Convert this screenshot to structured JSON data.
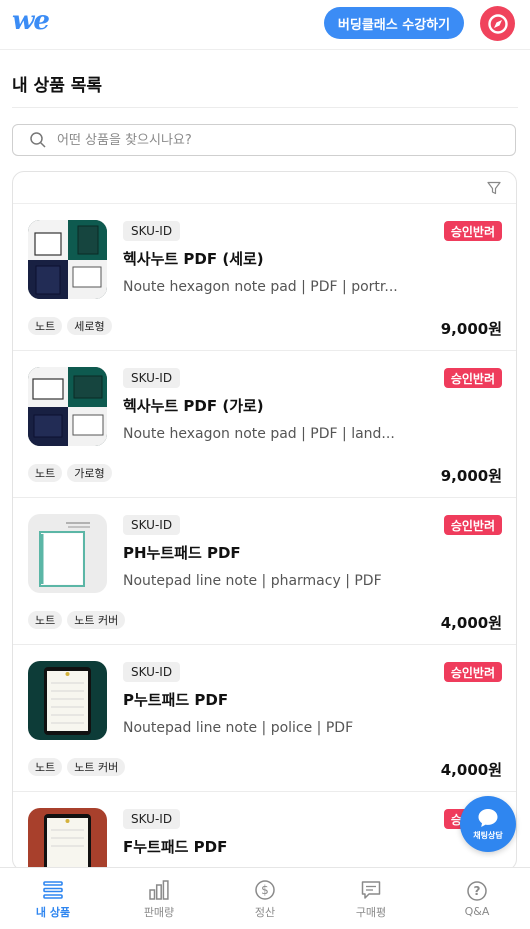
{
  "header": {
    "logo": "we",
    "cta_label": "버딩클래스 수강하기",
    "profile_icon": "compass-icon",
    "brand_color": "#3b8cf5",
    "profile_color": "#f0435c"
  },
  "page": {
    "title": "내 상품 목록"
  },
  "search": {
    "placeholder": "어떤 상품을 찾으시나요?",
    "value": ""
  },
  "filter": {
    "icon": "filter-icon"
  },
  "products": [
    {
      "sku": "SKU-ID",
      "status": "승인반려",
      "name": "헥사누트 PDF (세로)",
      "description": "Noute hexagon note pad | PDF | portr...",
      "tags": [
        "노트",
        "세로형"
      ],
      "price": "9,000원"
    },
    {
      "sku": "SKU-ID",
      "status": "승인반려",
      "name": "헥사누트 PDF (가로)",
      "description": "Noute hexagon note pad | PDF | land...",
      "tags": [
        "노트",
        "가로형"
      ],
      "price": "9,000원"
    },
    {
      "sku": "SKU-ID",
      "status": "승인반려",
      "name": "PH누트패드 PDF",
      "description": "Noutepad line note | pharmacy | PDF",
      "tags": [
        "노트",
        "노트 커버"
      ],
      "price": "4,000원"
    },
    {
      "sku": "SKU-ID",
      "status": "승인반려",
      "name": "P누트패드 PDF",
      "description": "Noutepad line note | police | PDF",
      "tags": [
        "노트",
        "노트 커버"
      ],
      "price": "4,000원"
    },
    {
      "sku": "SKU-ID",
      "status": "승인반려",
      "name": "F누트패드 PDF",
      "description": "",
      "tags": [],
      "price": ""
    }
  ],
  "status_color": "#ef3c5c",
  "chat": {
    "label": "채팅상담",
    "icon": "chat-bubble-icon"
  },
  "nav": [
    {
      "label": "내 상품",
      "icon": "list-icon",
      "active": true
    },
    {
      "label": "판매량",
      "icon": "bar-chart-icon",
      "active": false
    },
    {
      "label": "정산",
      "icon": "dollar-icon",
      "active": false
    },
    {
      "label": "구매평",
      "icon": "review-icon",
      "active": false
    },
    {
      "label": "Q&A",
      "icon": "question-icon",
      "active": false
    }
  ]
}
